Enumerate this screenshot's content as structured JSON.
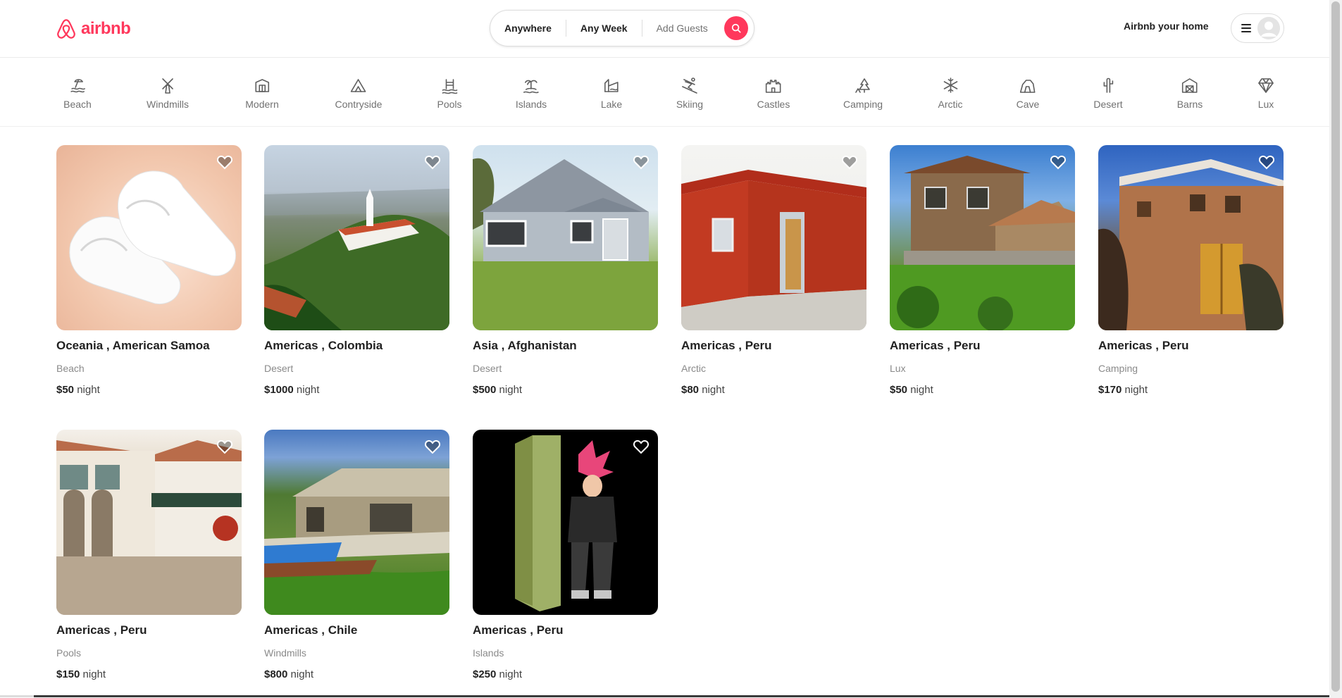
{
  "header": {
    "brand": "airbnb",
    "search": {
      "where": "Anywhere",
      "when": "Any Week",
      "guests": "Add Guests"
    },
    "host_link": "Airbnb your home",
    "icons": {
      "logo": "airbnb-logo-icon",
      "search": "search-icon",
      "menu": "hamburger-menu-icon",
      "avatar": "user-avatar-icon"
    }
  },
  "categories": [
    {
      "label": "Beach",
      "icon": "beach-icon"
    },
    {
      "label": "Windmills",
      "icon": "windmill-icon"
    },
    {
      "label": "Modern",
      "icon": "modern-house-icon"
    },
    {
      "label": "Contryside",
      "icon": "countryside-icon"
    },
    {
      "label": "Pools",
      "icon": "pool-icon"
    },
    {
      "label": "Islands",
      "icon": "island-icon"
    },
    {
      "label": "Lake",
      "icon": "lake-icon"
    },
    {
      "label": "Skiing",
      "icon": "skiing-icon"
    },
    {
      "label": "Castles",
      "icon": "castle-icon"
    },
    {
      "label": "Camping",
      "icon": "camping-icon"
    },
    {
      "label": "Arctic",
      "icon": "snowflake-icon"
    },
    {
      "label": "Cave",
      "icon": "cave-icon"
    },
    {
      "label": "Desert",
      "icon": "cactus-icon"
    },
    {
      "label": "Barns",
      "icon": "barn-icon"
    },
    {
      "label": "Lux",
      "icon": "diamond-icon"
    }
  ],
  "listings": [
    {
      "title": "Oceania , American Samoa",
      "category": "Beach",
      "price": "$50",
      "unit": "night",
      "photo": "white sneakers"
    },
    {
      "title": "Americas , Colombia",
      "category": "Desert",
      "price": "$1000",
      "unit": "night",
      "photo": "hilltop church city view"
    },
    {
      "title": "Asia , Afghanistan",
      "category": "Desert",
      "price": "$500",
      "unit": "night",
      "photo": "grey house with lawn"
    },
    {
      "title": "Americas , Peru",
      "category": "Arctic",
      "price": "$80",
      "unit": "night",
      "photo": "red brick house"
    },
    {
      "title": "Americas , Peru",
      "category": "Lux",
      "price": "$50",
      "unit": "night",
      "photo": "two-storey house with garden"
    },
    {
      "title": "Americas , Peru",
      "category": "Camping",
      "price": "$170",
      "unit": "night",
      "photo": "adobe house with wooden doors"
    },
    {
      "title": "Americas , Peru",
      "category": "Pools",
      "price": "$150",
      "unit": "night",
      "photo": "colonial courtyard"
    },
    {
      "title": "Americas , Chile",
      "category": "Windmills",
      "price": "$800",
      "unit": "night",
      "photo": "villa with pool"
    },
    {
      "title": "Americas , Peru",
      "category": "Islands",
      "price": "$250",
      "unit": "night",
      "photo": "anime figure in box"
    }
  ],
  "colors": {
    "brand": "#ff385c",
    "text": "#222222",
    "muted": "#717171"
  }
}
